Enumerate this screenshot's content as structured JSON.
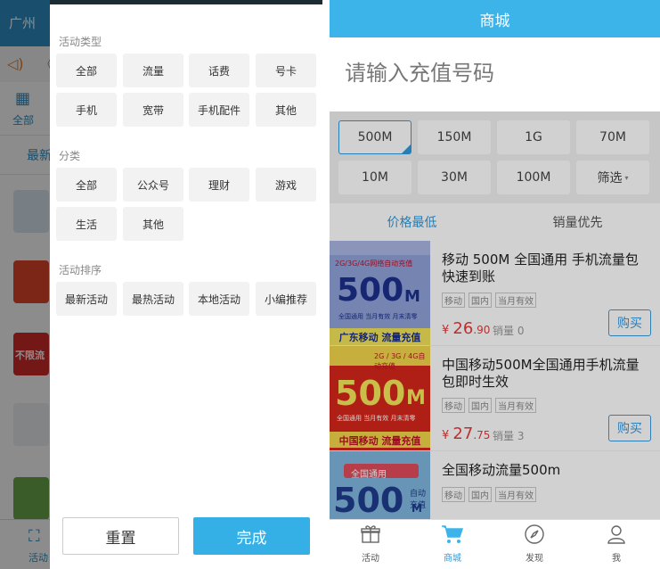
{
  "left": {
    "background": {
      "city": "广州",
      "notice_more": "《",
      "category_label": "全部",
      "tab_label": "最新",
      "banner_text": "不限流",
      "tabbar_label": "活动"
    },
    "drawer": {
      "sections": [
        {
          "title": "活动类型",
          "options": [
            "全部",
            "流量",
            "话费",
            "号卡",
            "手机",
            "宽带",
            "手机配件",
            "其他"
          ]
        },
        {
          "title": "分类",
          "options": [
            "全部",
            "公众号",
            "理财",
            "游戏",
            "生活",
            "其他"
          ]
        },
        {
          "title": "活动排序",
          "options": [
            "最新活动",
            "最热活动",
            "本地活动",
            "小编推荐"
          ]
        }
      ],
      "reset_label": "重置",
      "done_label": "完成"
    }
  },
  "right": {
    "header_title": "商城",
    "input_placeholder": "请输入充值号码",
    "options": [
      "500M",
      "150M",
      "1G",
      "70M",
      "10M",
      "30M",
      "100M",
      "筛选"
    ],
    "selected_option": "500M",
    "sort_tabs": [
      "价格最低",
      "销量优先"
    ],
    "products": [
      {
        "name": "移动 500M 全国通用 手机流量包 快速到账",
        "tags": [
          "移动",
          "国内",
          "当月有效"
        ],
        "price_symbol": "¥",
        "price_int": "26",
        "price_dec": ".90",
        "sold": "销量 0",
        "buy_label": "购买",
        "image": {
          "top": "2G/3G/4G网络自动充值",
          "big": "500",
          "unit": "M",
          "small": "全国通用 当月有效 月末清零",
          "foot": "广东移动 流量充值"
        }
      },
      {
        "name": "中国移动500M全国通用手机流量包即时生效",
        "tags": [
          "移动",
          "国内",
          "当月有效"
        ],
        "price_symbol": "¥",
        "price_int": "27",
        "price_dec": ".75",
        "sold": "销量 3",
        "buy_label": "购买",
        "image": {
          "top": "2G / 3G / 4G自动充值",
          "big": "500",
          "unit": "M",
          "small": "全国通用 当月有效 月末清零",
          "foot": "中国移动 流量充值"
        }
      },
      {
        "name": "全国移动流量500m",
        "tags": [
          "移动",
          "国内",
          "当月有效"
        ],
        "image": {
          "top": "全国通用",
          "big": "500",
          "unit": "M",
          "small": "自动充值"
        }
      }
    ],
    "tabbar": [
      {
        "label": "活动",
        "icon": "gift-icon"
      },
      {
        "label": "商城",
        "icon": "cart-icon"
      },
      {
        "label": "发现",
        "icon": "compass-icon"
      },
      {
        "label": "我",
        "icon": "person-icon"
      }
    ],
    "colors": {
      "accent": "#3cb4ea",
      "price": "#e23b3b",
      "done": "#35b0e6"
    }
  }
}
